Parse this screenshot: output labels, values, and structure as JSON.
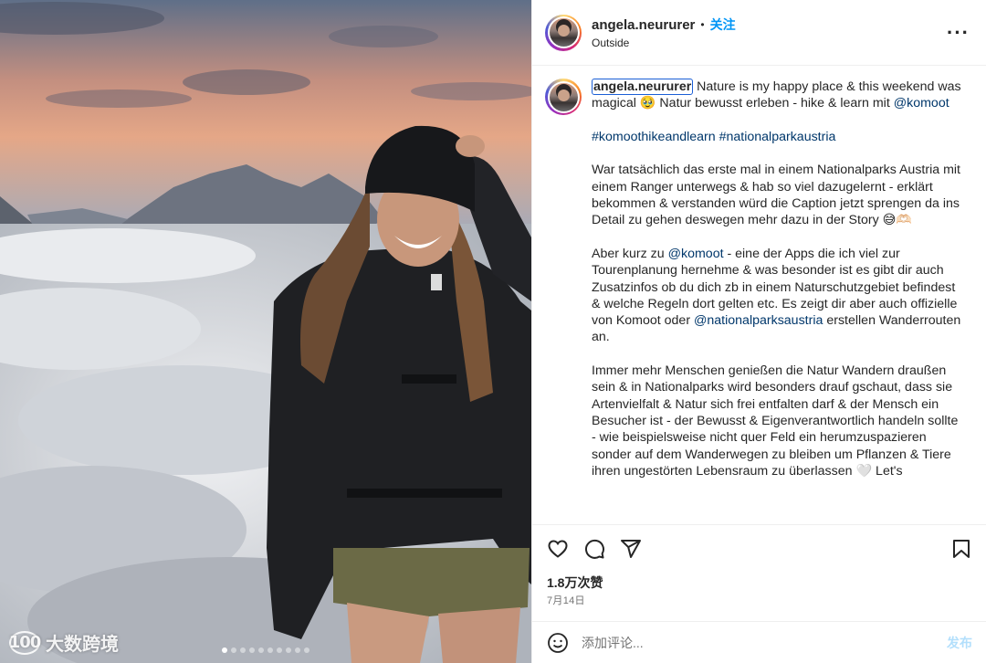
{
  "post": {
    "username": "angela.neururer",
    "follow_label": "关注",
    "separator": "•",
    "location": "Outside",
    "more_icon": "more-horizontal-icon"
  },
  "caption": {
    "username": "angela.neururer",
    "para1_text": " Nature is my happy place & this weekend was magical 🥹 Natur bewusst erleben - hike & learn mit ",
    "para1_mention": "@komoot",
    "hashtag1": "#komoothikeandlearn",
    "hashtag2": "#nationalparkaustria",
    "para3": "War tatsächlich das erste mal in einem Nationalparks Austria mit einem Ranger unterwegs & hab so viel dazugelernt - erklärt bekommen & verstanden würd die Caption jetzt sprengen da ins Detail zu gehen deswegen mehr dazu in der Story 😅🫶🏻",
    "para4_a": "Aber kurz zu ",
    "para4_mention1": "@komoot",
    "para4_b": " - eine der Apps die ich viel zur Tourenplanung hernehme & was besonder ist es gibt dir auch Zusatzinfos ob du dich zb in einem Naturschutzgebiet befindest & welche Regeln dort gelten etc. Es zeigt dir aber auch offizielle von Komoot oder ",
    "para4_mention2": "@nationalparksaustria",
    "para4_c": " erstellen Wanderrouten an.",
    "para5": "Immer mehr Menschen genießen die Natur Wandern draußen sein & in Nationalparks wird besonders drauf gschaut, dass sie Artenvielfalt & Natur sich frei entfalten darf & der Mensch ein Besucher ist - der Bewusst & Eigenverantwortlich handeln sollte - wie beispielsweise nicht quer Feld ein herumzuspazieren sonder auf dem Wanderwegen zu bleiben um Pflanzen & Tiere ihren ungestörten Lebensraum zu überlassen 🤍 Let's"
  },
  "actions": {
    "like_icon": "heart-icon",
    "comment_icon": "comment-icon",
    "share_icon": "share-icon",
    "save_icon": "bookmark-icon"
  },
  "stats": {
    "likes": "1.8万次赞",
    "date": "7月14日"
  },
  "comment": {
    "emoji_icon": "emoji-icon",
    "placeholder": "添加评论...",
    "post_label": "发布"
  },
  "carousel": {
    "total": 10,
    "active_index": 0
  },
  "watermark": {
    "logo": "100",
    "text": "大数跨境"
  },
  "colors": {
    "accent": "#0095f6",
    "link": "#00376b",
    "post_disabled": "#b2dffc"
  }
}
